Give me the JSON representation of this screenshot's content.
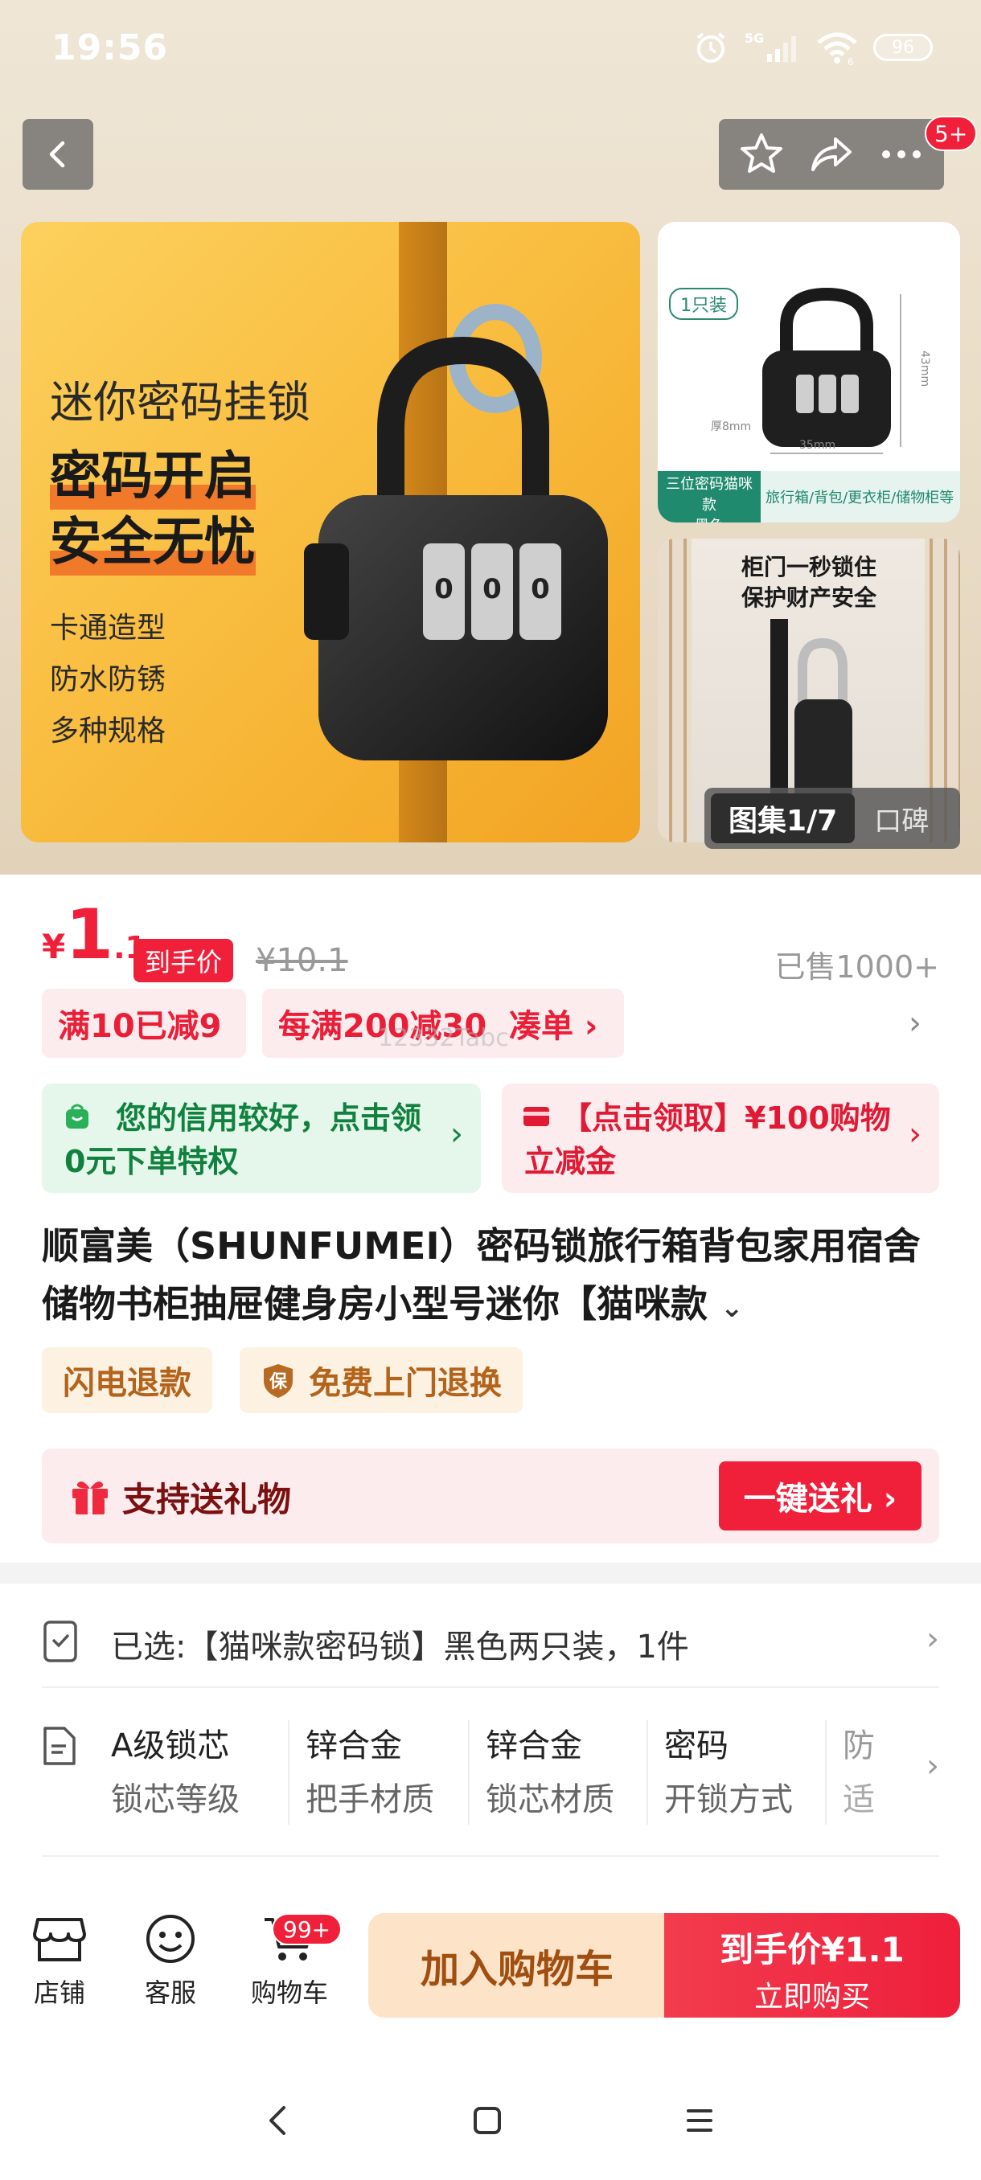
{
  "status_bar": {
    "time": "19:56",
    "network": "5G",
    "wifi_sub": "6",
    "battery": "96"
  },
  "nav": {
    "message_badge": "5+"
  },
  "gallery": {
    "main": {
      "headline": "迷你密码挂锁",
      "slogan_1": "密码开启",
      "slogan_2": "安全无忧",
      "features": [
        "卡通造型",
        "防水防锈",
        "多种规格"
      ]
    },
    "thumb1": {
      "pack": "1只装",
      "dim_w": "35mm",
      "dim_d": "厚8mm",
      "dim_h": "43mm",
      "label_left_1": "三位密码猫咪款",
      "label_left_2": "黑色",
      "label_right": "旅行箱/背包/更衣柜/储物柜等"
    },
    "thumb2": {
      "caption_1": "柜门一秒锁住",
      "caption_2": "保护财产安全"
    },
    "counter_active": "图集1/7",
    "counter_other": "口碑"
  },
  "price": {
    "currency": "¥",
    "integer": "1",
    "decimal": ".1",
    "tag": "到手价",
    "original": "¥10.1",
    "sold": "已售1000+"
  },
  "promos": [
    {
      "text": "满10已减9"
    },
    {
      "text": "每满200减30  凑单 ›"
    }
  ],
  "watermark": "12332Tabc",
  "credit": {
    "text": "您的信用较好，点击领0元下单特权"
  },
  "coupon": {
    "text": "【点击领取】¥100购物立减金"
  },
  "title": "顺富美（SHUNFUMEI）密码锁旅行箱背包家用宿舍储物书柜抽屉健身房小型号迷你【猫咪款",
  "services": [
    "闪电退款",
    "免费上门退换"
  ],
  "gift": {
    "label": "支持送礼物",
    "button": "一键送礼 ›"
  },
  "selection": {
    "text": "已选:【猫咪款密码锁】黑色两只装，1件"
  },
  "specs": [
    {
      "value": "A级锁芯",
      "key": "锁芯等级"
    },
    {
      "value": "锌合金",
      "key": "把手材质"
    },
    {
      "value": "锌合金",
      "key": "锁芯材质"
    },
    {
      "value": "密码",
      "key": "开锁方式"
    },
    {
      "value": "防",
      "key": "适"
    }
  ],
  "bottom_bar": {
    "store": "店铺",
    "service": "客服",
    "cart": "购物车",
    "cart_badge": "99+",
    "add_to_cart": "加入购物车",
    "buy_line1": "到手价¥1.1",
    "buy_line2": "立即购买"
  },
  "colors": {
    "accent_red": "#f0203a",
    "credit_green": "#11813f",
    "service_orange": "#b3631a"
  },
  "icons": [
    "back-icon",
    "star-icon",
    "share-icon",
    "more-icon",
    "gift-icon",
    "store-icon",
    "service-icon",
    "cart-icon"
  ]
}
